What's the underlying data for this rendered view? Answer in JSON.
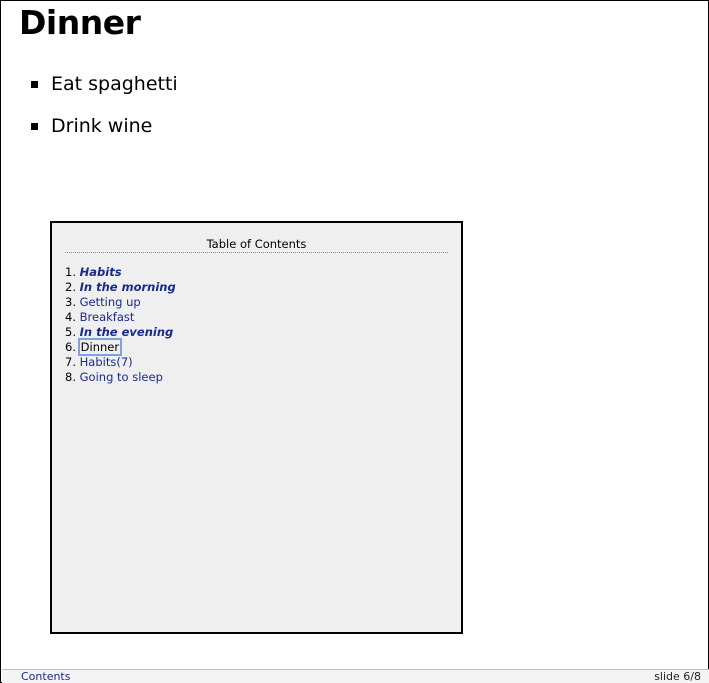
{
  "slide": {
    "title": "Dinner",
    "bullets": [
      "Eat spaghetti",
      "Drink wine"
    ]
  },
  "toc": {
    "heading": "Table of Contents",
    "items": [
      {
        "num": "1.",
        "label": "Habits",
        "style": "section"
      },
      {
        "num": "2.",
        "label": "In the morning",
        "style": "section"
      },
      {
        "num": "3.",
        "label": "Getting up",
        "style": "normal"
      },
      {
        "num": "4.",
        "label": "Breakfast",
        "style": "normal"
      },
      {
        "num": "5.",
        "label": "In the evening",
        "style": "section"
      },
      {
        "num": "6.",
        "label": "Dinner",
        "style": "current"
      },
      {
        "num": "7.",
        "label": "Habits(7)",
        "style": "normal"
      },
      {
        "num": "8.",
        "label": "Going to sleep",
        "style": "normal"
      }
    ]
  },
  "footer": {
    "contents_link": "Contents",
    "slide_counter": "slide 6/8"
  },
  "colors": {
    "link": "#1a2a8a",
    "toc_background": "#efefef",
    "focus_ring": "#7aa3e0"
  }
}
